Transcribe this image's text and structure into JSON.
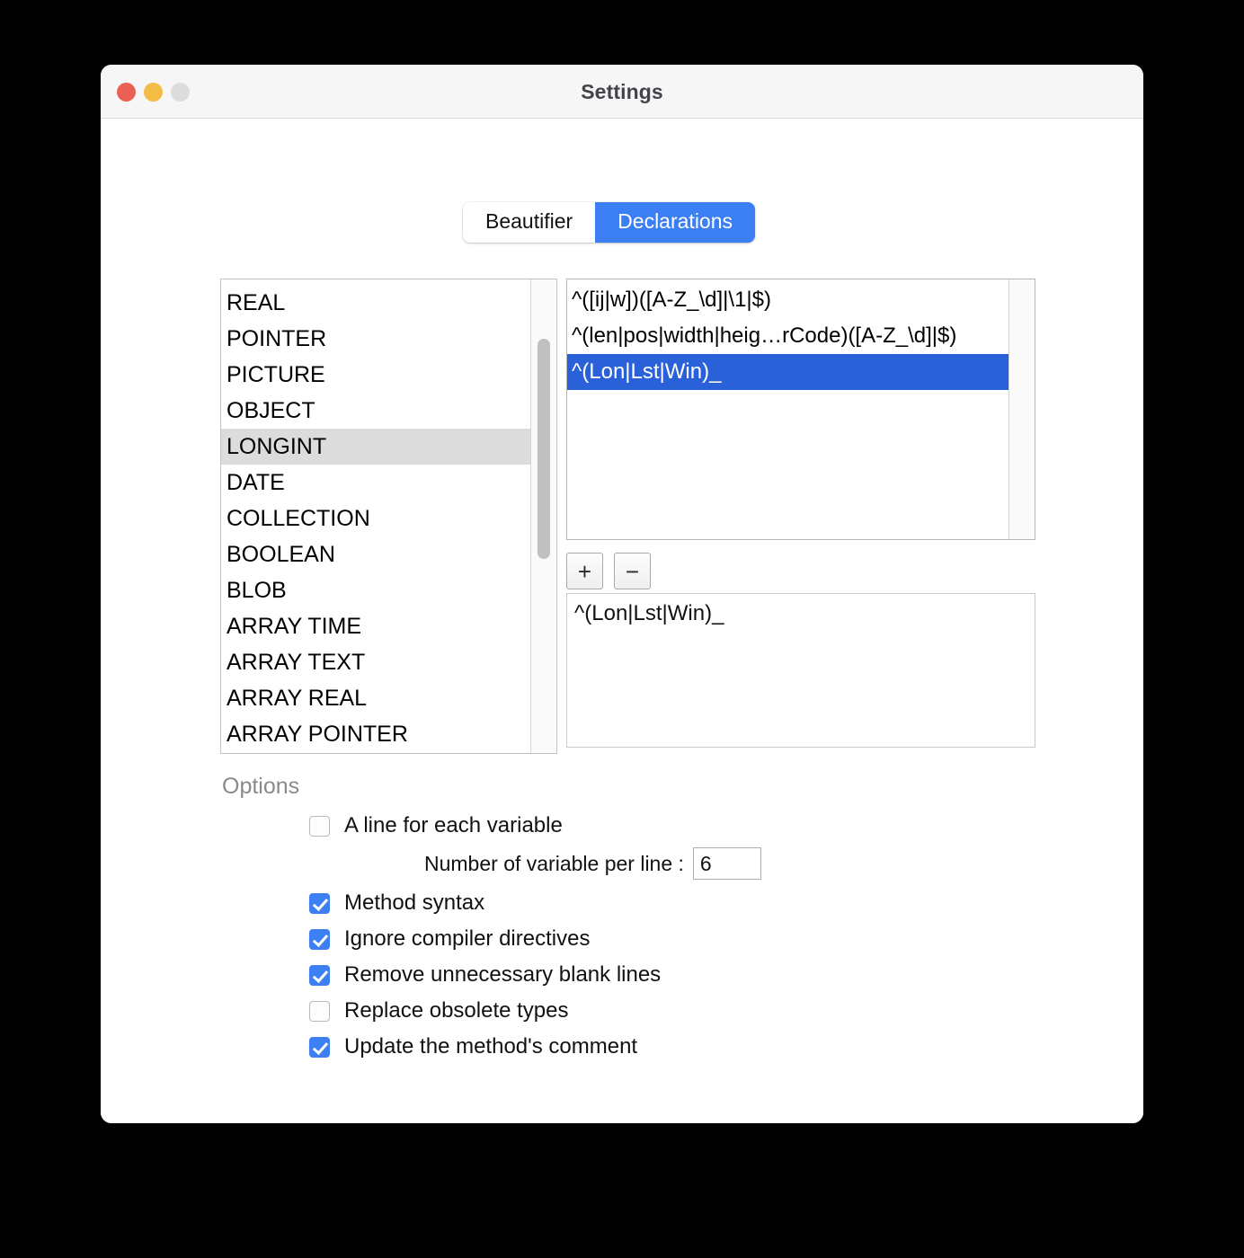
{
  "window": {
    "title": "Settings",
    "traffic_lights": [
      {
        "name": "close",
        "color": "#ea6055"
      },
      {
        "name": "minimize",
        "color": "#f3bc44"
      },
      {
        "name": "zoom",
        "color": "#dcdcdc"
      }
    ]
  },
  "tabs": [
    {
      "label": "Beautifier",
      "active": false
    },
    {
      "label": "Declarations",
      "active": true
    }
  ],
  "type_list": {
    "items": [
      {
        "label": "REAL",
        "selected": false
      },
      {
        "label": "POINTER",
        "selected": false
      },
      {
        "label": "PICTURE",
        "selected": false
      },
      {
        "label": "OBJECT",
        "selected": false
      },
      {
        "label": "LONGINT",
        "selected": true
      },
      {
        "label": "DATE",
        "selected": false
      },
      {
        "label": "COLLECTION",
        "selected": false
      },
      {
        "label": "BOOLEAN",
        "selected": false
      },
      {
        "label": "BLOB",
        "selected": false
      },
      {
        "label": "ARRAY TIME",
        "selected": false
      },
      {
        "label": "ARRAY TEXT",
        "selected": false
      },
      {
        "label": "ARRAY REAL",
        "selected": false
      },
      {
        "label": "ARRAY POINTER",
        "selected": false
      }
    ]
  },
  "regex_list": {
    "items": [
      {
        "pattern": "^([ij|w])([A-Z_\\d]|\\1|$)",
        "selected": false
      },
      {
        "pattern": "^(len|pos|width|heig…rCode)([A-Z_\\d]|$)",
        "selected": false
      },
      {
        "pattern": "^(Lon|Lst|Win)_",
        "selected": true
      }
    ]
  },
  "buttons": {
    "add_label": "+",
    "remove_label": "−"
  },
  "regex_editor": {
    "value": "^(Lon|Lst|Win)_"
  },
  "options": {
    "title": "Options",
    "items": [
      {
        "label": "A line for each variable",
        "checked": false
      },
      {
        "label": "Method syntax",
        "checked": true
      },
      {
        "label": "Ignore compiler directives",
        "checked": true
      },
      {
        "label": "Remove unnecessary blank lines",
        "checked": true
      },
      {
        "label": "Replace obsolete types",
        "checked": false
      },
      {
        "label": "Update the method's comment",
        "checked": true
      }
    ],
    "variables_per_line": {
      "label": "Number of variable per line :",
      "value": "6"
    }
  },
  "colors": {
    "accent": "#3b7ff2",
    "selection_blue": "#2a61d8",
    "selection_gray": "#dcdcdc"
  }
}
